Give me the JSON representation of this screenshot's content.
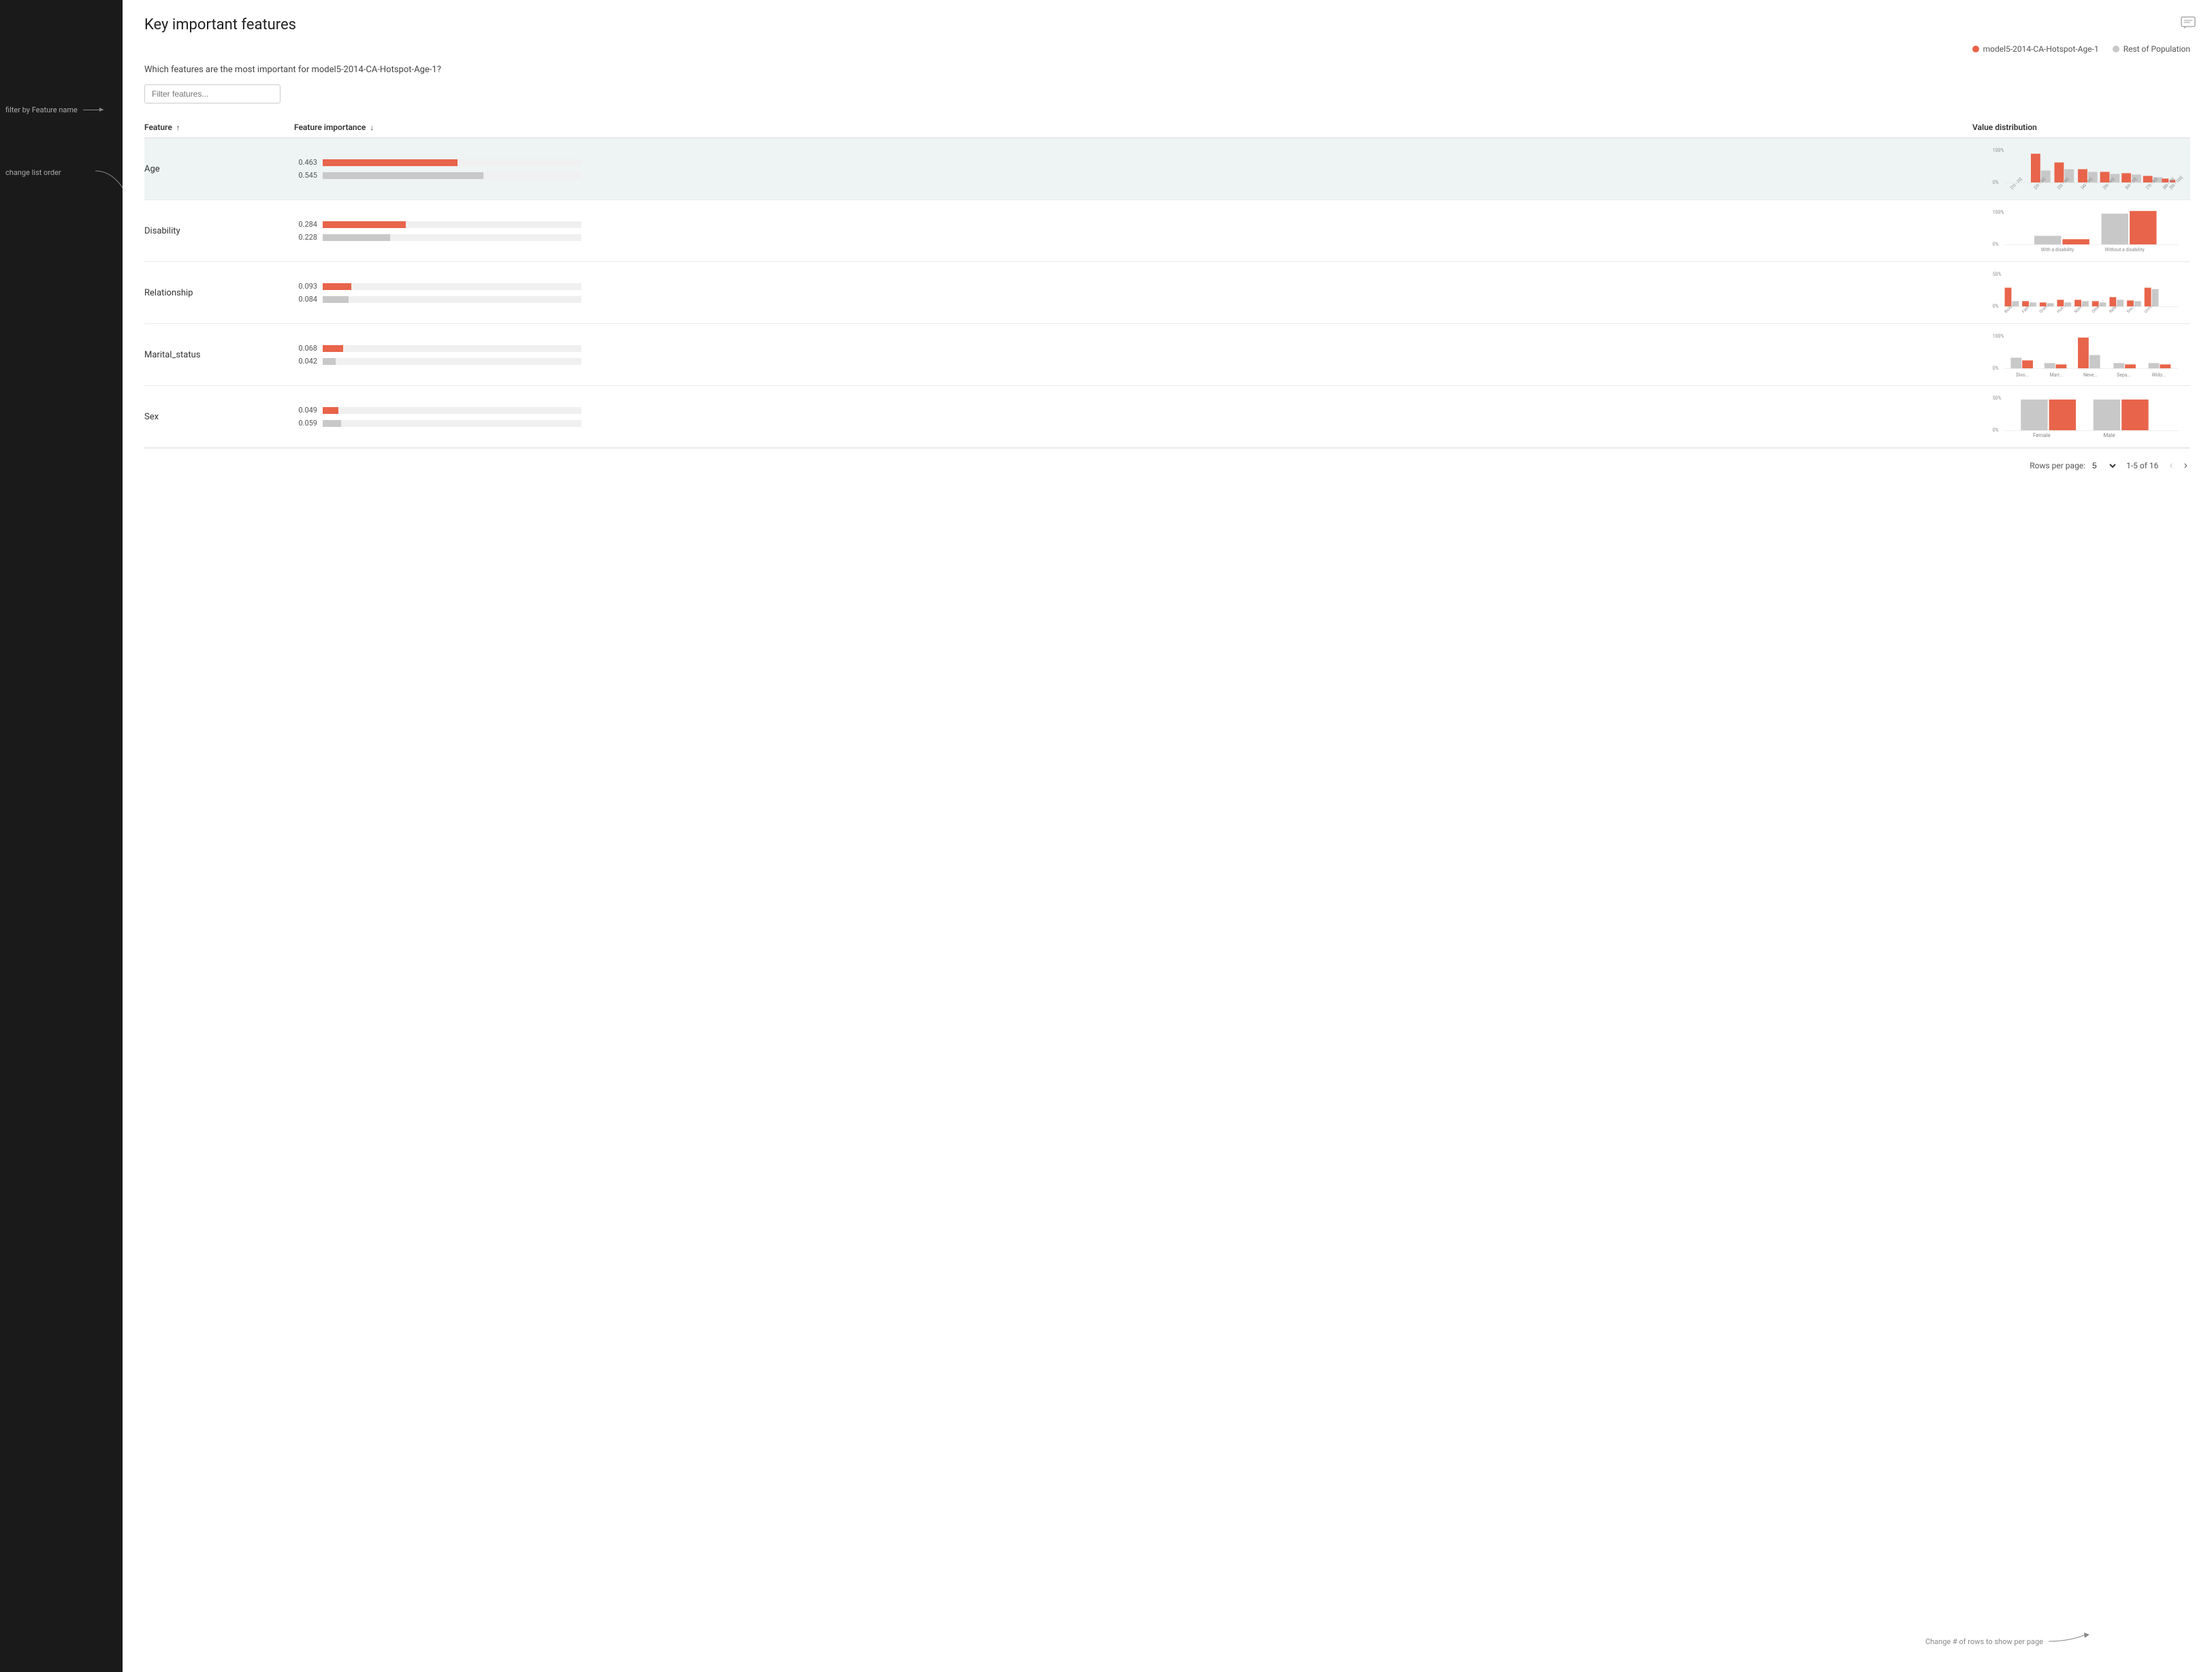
{
  "page": {
    "title": "Key important features",
    "subtitle": "Which features are the most important for model5-2014-CA-Hotspot-Age-1?",
    "comment_icon": "💬"
  },
  "legend": {
    "model_label": "model5-2014-CA-Hotspot-Age-1",
    "model_color": "#e8644a",
    "population_label": "Rest of Population",
    "population_color": "#c8c8c8"
  },
  "filter": {
    "placeholder": "Filter features..."
  },
  "table": {
    "headers": {
      "feature": "Feature",
      "importance": "Feature importance",
      "distribution": "Value distribution"
    },
    "rows": [
      {
        "name": "Age",
        "highlighted": true,
        "model_value": "0.463",
        "model_bar_pct": 52,
        "pop_value": "0.545",
        "pop_bar_pct": 62
      },
      {
        "name": "Disability",
        "highlighted": false,
        "model_value": "0.284",
        "model_bar_pct": 32,
        "pop_value": "0.228",
        "pop_bar_pct": 26
      },
      {
        "name": "Relationship",
        "highlighted": false,
        "model_value": "0.093",
        "model_bar_pct": 11,
        "pop_value": "0.084",
        "pop_bar_pct": 10
      },
      {
        "name": "Marital_status",
        "highlighted": false,
        "model_value": "0.068",
        "model_bar_pct": 8,
        "pop_value": "0.042",
        "pop_bar_pct": 5
      },
      {
        "name": "Sex",
        "highlighted": false,
        "model_value": "0.049",
        "model_bar_pct": 6,
        "pop_value": "0.059",
        "pop_bar_pct": 7
      }
    ]
  },
  "pagination": {
    "rows_per_page_label": "Rows per page:",
    "rows_per_page_value": "5",
    "page_info": "1-5 of 16"
  },
  "annotations": {
    "filter_label": "filter by Feature name",
    "order_label": "change list order",
    "rows_label": "Change # of rows to show per page"
  }
}
